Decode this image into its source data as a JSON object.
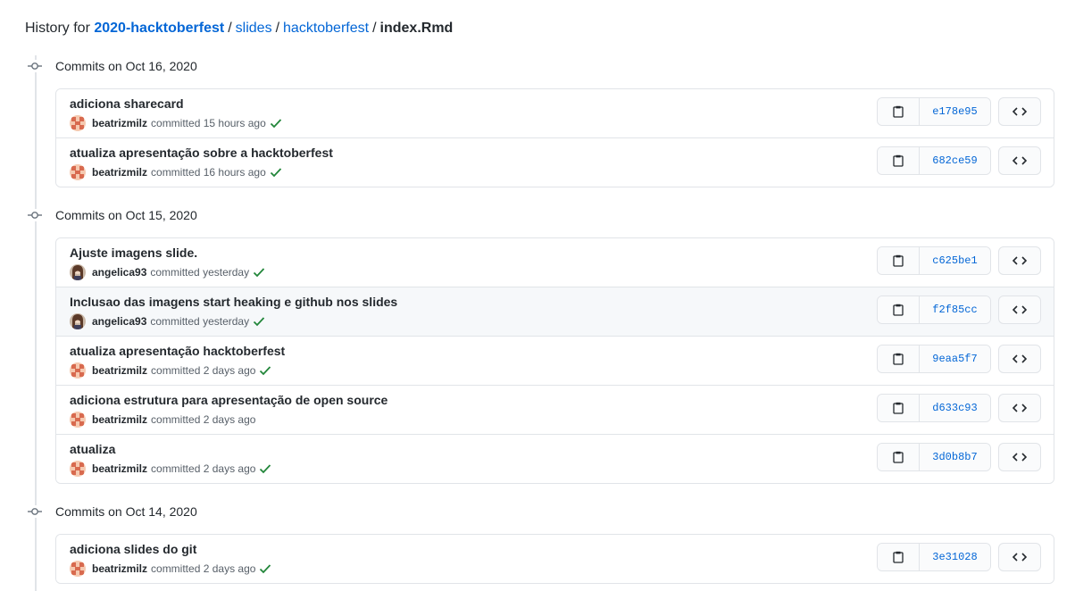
{
  "breadcrumb": {
    "lead": "History for",
    "repo": "2020-hacktoberfest",
    "sep": "/",
    "path1": "slides",
    "path2": "hacktoberfest",
    "file": "index.Rmd"
  },
  "icons": {
    "commit_node": "git-commit-icon",
    "copy": "clipboard-icon",
    "browse": "code-icon",
    "status": "check-icon",
    "avatar": "avatar"
  },
  "colors": {
    "link": "#0366d6",
    "success": "#22863a",
    "border": "#e1e4e8"
  },
  "groups": [
    {
      "title": "Commits on Oct 16, 2020",
      "commits": [
        {
          "message": "adiciona sharecard",
          "author": "beatrizmilz",
          "verb": "committed",
          "time": "15 hours ago",
          "sha": "e178e95",
          "check": true
        },
        {
          "message": "atualiza apresentação sobre a hacktoberfest",
          "author": "beatrizmilz",
          "verb": "committed",
          "time": "16 hours ago",
          "sha": "682ce59",
          "check": true
        }
      ]
    },
    {
      "title": "Commits on Oct 15, 2020",
      "commits": [
        {
          "message": "Ajuste imagens slide.",
          "author": "angelica93",
          "verb": "committed",
          "time": "yesterday",
          "sha": "c625be1",
          "check": true
        },
        {
          "message": "Inclusao das imagens start heaking e github nos slides",
          "author": "angelica93",
          "verb": "committed",
          "time": "yesterday",
          "sha": "f2f85cc",
          "check": true
        },
        {
          "message": "atualiza apresentação hacktoberfest",
          "author": "beatrizmilz",
          "verb": "committed",
          "time": "2 days ago",
          "sha": "9eaa5f7",
          "check": true
        },
        {
          "message": "adiciona estrutura para apresentação de open source",
          "author": "beatrizmilz",
          "verb": "committed",
          "time": "2 days ago",
          "sha": "d633c93",
          "check": false
        },
        {
          "message": "atualiza",
          "author": "beatrizmilz",
          "verb": "committed",
          "time": "2 days ago",
          "sha": "3d0b8b7",
          "check": true
        }
      ]
    },
    {
      "title": "Commits on Oct 14, 2020",
      "commits": [
        {
          "message": "adiciona slides do git",
          "author": "beatrizmilz",
          "verb": "committed",
          "time": "2 days ago",
          "sha": "3e31028",
          "check": true
        }
      ]
    }
  ]
}
